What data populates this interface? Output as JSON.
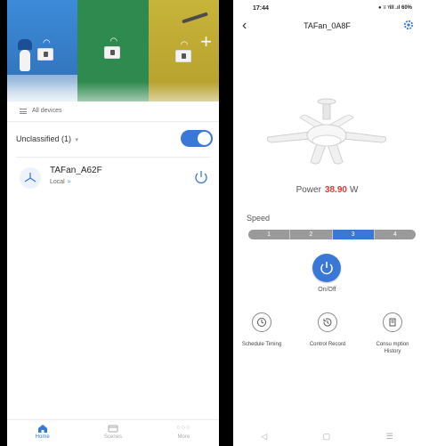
{
  "left": {
    "all_devices_label": "All devices",
    "group_label": "Unclassified (1)",
    "group_toggle_on": true,
    "device": {
      "name": "TAFan_A62F",
      "connection": "Local",
      "icon": "ceiling-fan-icon"
    },
    "tabs": [
      {
        "label": "Home",
        "icon": "home-icon",
        "active": true
      },
      {
        "label": "Scenes",
        "icon": "scenes-icon",
        "active": false
      },
      {
        "label": "More",
        "icon": "more-icon",
        "active": false
      }
    ],
    "accent_color": "#3a78d8"
  },
  "right": {
    "status": {
      "time": "17:44",
      "icons_text": "● ≡ ᵞill .ıl 60%"
    },
    "title": "TAFan_0A8F",
    "power": {
      "label": "Power",
      "value": "38.90",
      "unit": "W",
      "value_color": "#e53935"
    },
    "speed": {
      "label": "Speed",
      "levels": [
        "1",
        "2",
        "3",
        "4"
      ],
      "selected": "3"
    },
    "onoff_label": "On/Off",
    "features": [
      {
        "label": "Schedule Timing",
        "icon": "clock-icon"
      },
      {
        "label": "Control Record",
        "icon": "history-icon"
      },
      {
        "label": "Consu mption History",
        "icon": "receipt-icon"
      }
    ]
  }
}
